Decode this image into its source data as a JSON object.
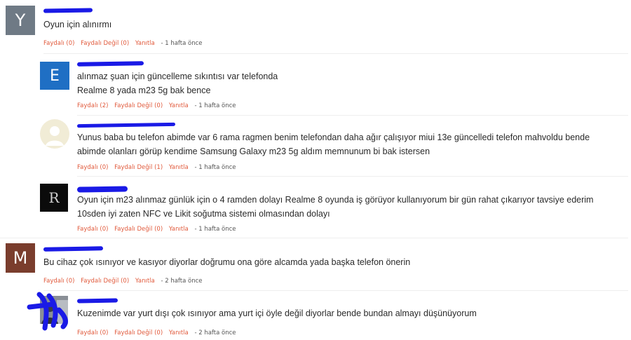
{
  "comments": [
    {
      "initial": "Y",
      "avatar_color": "#6f7a85",
      "text": "Oyun için alınırmı",
      "helpful": "Faydalı (0)",
      "not_helpful": "Faydalı Değil (0)",
      "reply": "Yanıtla",
      "time": "- 1 hafta önce"
    },
    {
      "initial": "E",
      "avatar_color": "#1f6fc4",
      "text": "alınmaz şuan için güncelleme sıkıntısı var telefonda\nRealme 8 yada m23 5g bak bence",
      "helpful": "Faydalı (2)",
      "not_helpful": "Faydalı Değil (0)",
      "reply": "Yanıtla",
      "time": "- 1 hafta önce"
    },
    {
      "initial": "",
      "avatar_color": "#f1ecd6",
      "text": "Yunus baba bu telefon abimde var 6 rama ragmen benim telefondan daha ağır çalışıyor miui 13e güncelledi telefon mahvoldu bende\nabimde olanları görüp kendime Samsung Galaxy m23 5g aldım memnunum bi bak istersen",
      "helpful": "Faydalı (0)",
      "not_helpful": "Faydalı Değil (1)",
      "reply": "Yanıtla",
      "time": "- 1 hafta önce"
    },
    {
      "initial": "R",
      "avatar_color": "#0b0b0b",
      "text": "Oyun için m23 alınmaz günlük için o 4 ramden dolayı Realme 8 oyunda iş görüyor kullanıyorum bir gün rahat çıkarıyor tavsiye ederim\n10sden iyi zaten NFC ve Likit soğutma sistemi olmasından dolayı",
      "helpful": "Faydalı (0)",
      "not_helpful": "Faydalı Değil (0)",
      "reply": "Yanıtla",
      "time": "- 1 hafta önce"
    },
    {
      "initial": "M",
      "avatar_color": "#7a3d2d",
      "text": "Bu cihaz çok ısınıyor ve kasıyor diyorlar doğrumu ona göre alcamda yada başka telefon önerin",
      "helpful": "Faydalı (0)",
      "not_helpful": "Faydalı Değil (0)",
      "reply": "Yanıtla",
      "time": "- 2 hafta önce"
    },
    {
      "initial": "",
      "avatar_color": "#5b6470",
      "text": "Kuzenimde var yurt dışı çok ısınıyor ama yurt içi öyle değil diyorlar bende bundan almayı düşünüyorum",
      "helpful": "Faydalı (0)",
      "not_helpful": "Faydalı Değil (0)",
      "reply": "Yanıtla",
      "time": "- 2 hafta önce"
    }
  ]
}
